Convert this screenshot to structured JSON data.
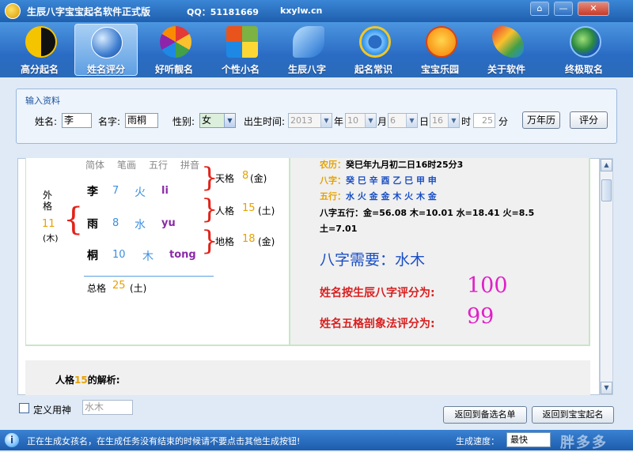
{
  "window": {
    "title": "生辰八字宝宝起名软件正式版",
    "qq": "QQ：51181669",
    "site": "kxylw.cn",
    "buttons": [
      "⌂",
      "—",
      "✕"
    ]
  },
  "toolbar": [
    {
      "label": "高分起名",
      "icon": "yinyang-icon",
      "active": false
    },
    {
      "label": "姓名评分",
      "icon": "globe-icon",
      "active": true
    },
    {
      "label": "好听靓名",
      "icon": "flower-icon",
      "active": false
    },
    {
      "label": "个性小名",
      "icon": "windows-logo-icon",
      "active": false
    },
    {
      "label": "生辰八字",
      "icon": "butterfly-icon",
      "active": false
    },
    {
      "label": "起名常识",
      "icon": "ie-logo-icon",
      "active": false
    },
    {
      "label": "宝宝乐园",
      "icon": "baby-face-icon",
      "active": false
    },
    {
      "label": "关于软件",
      "icon": "wings-logo-icon",
      "active": false
    },
    {
      "label": "终极取名",
      "icon": "earth-icon",
      "active": false
    }
  ],
  "input": {
    "group_title": "输入资料",
    "surname_label": "姓名:",
    "surname": "李",
    "given_label": "名字:",
    "given": "雨桐",
    "gender_label": "性别:",
    "gender": "女",
    "birth_label": "出生时间:",
    "year": "2013",
    "year_unit": "年",
    "month": "10",
    "month_unit": "月",
    "day": "6",
    "day_unit": "日",
    "hour": "16",
    "hour_unit": "时",
    "minute": "25",
    "minute_unit": "分",
    "calendar_button": "万年历",
    "score_button": "评分"
  },
  "wuge": {
    "headers": [
      "简体",
      "笔画",
      "五行",
      "拼音"
    ],
    "chars": [
      {
        "char": "李",
        "strokes": "7",
        "element": "火",
        "pinyin": "li"
      },
      {
        "char": "雨",
        "strokes": "8",
        "element": "水",
        "pinyin": "yu"
      },
      {
        "char": "桐",
        "strokes": "10",
        "element": "木",
        "pinyin": "tong"
      }
    ],
    "waige_label": "外格",
    "waige_num": "11",
    "waige_el": "(木)",
    "tiange_label": "天格",
    "tiange_num": "8",
    "tiange_el": "(金)",
    "renge_label": "人格",
    "renge_num": "15",
    "renge_el": "(土)",
    "dige_label": "地格",
    "dige_num": "18",
    "dige_el": "(金)",
    "zongge_label": "总格",
    "zongge_num": "25",
    "zongge_el": "(土)"
  },
  "bazi": {
    "nongli_label": "农历：",
    "nongli": "癸巳年九月初二日16时25分3",
    "bazi_label": "八字：",
    "bazi": "癸 巳 辛 酉 乙 巳 甲 申",
    "wuxing_label": "五行：",
    "wuxing": "水 火 金 金 木 火 木 金",
    "scores_line1": "八字五行：金=56.08 木=10.01 水=18.41 火=8.5",
    "scores_line2": "土=7.01",
    "need_label": "八字需要：",
    "need": "水木",
    "score1_label": "姓名按生辰八字评分为:",
    "score1": "100",
    "score2_label": "姓名五格剖象法评分为:",
    "score2": "99"
  },
  "analysis": {
    "prefix": "人格",
    "num": "15",
    "suffix": "的解析:"
  },
  "bottom": {
    "checkbox_label": "定义用神",
    "yongshen_value": "水木",
    "back_list_button": "返回到备选名单",
    "back_home_button": "返回到宝宝起名"
  },
  "status": {
    "message": "正在生成女孩名，在生成任务没有结束的时候请不要点击其他生成按钮!",
    "speed_label": "生成速度：",
    "speed_value": "最快",
    "watermark": "胖多多"
  },
  "colors": {
    "accent": "#2a6cc4",
    "number_orange": "#e6a100",
    "score_magenta": "#e020c8",
    "title_red": "#d92020",
    "need_blue": "#1a4fc4",
    "pinyin_purple": "#8a2ba6"
  }
}
